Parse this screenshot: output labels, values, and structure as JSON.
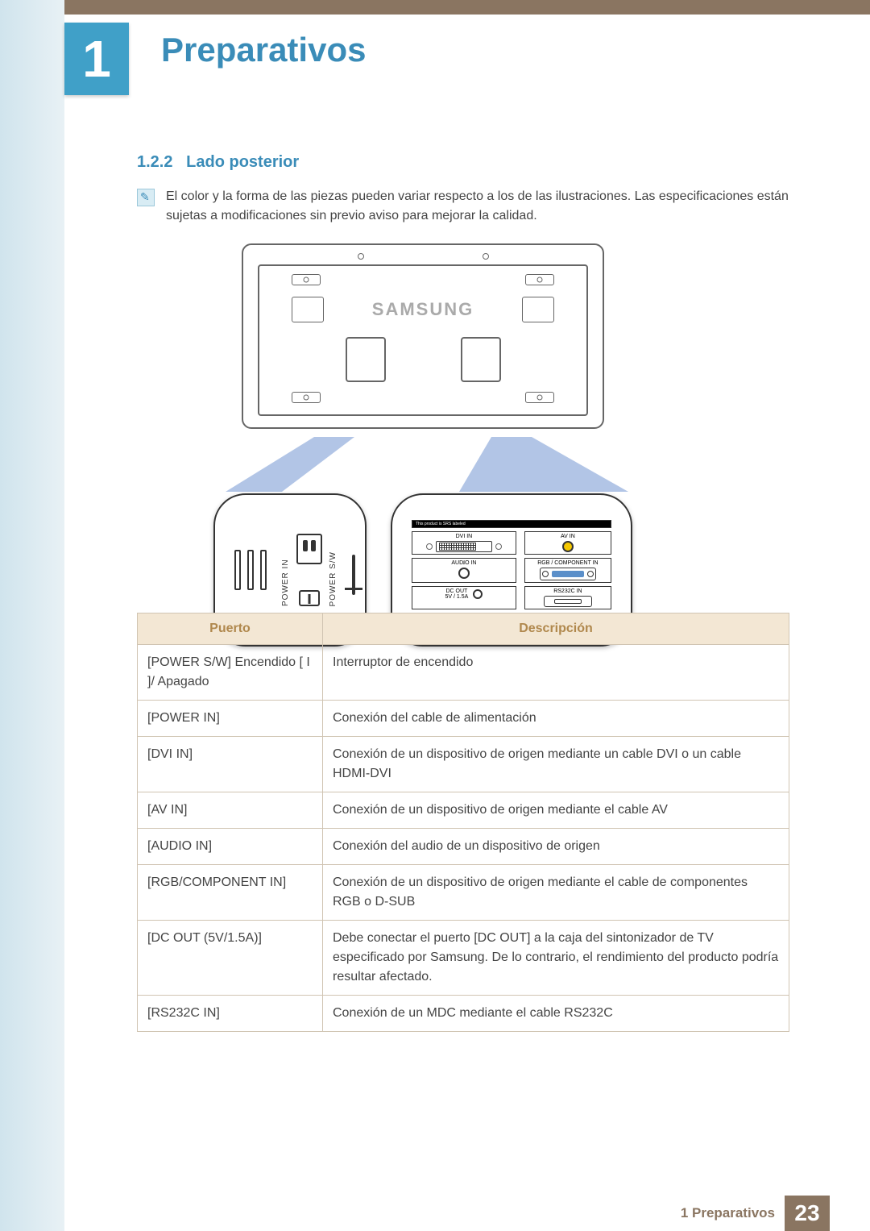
{
  "chapter": {
    "number": "1",
    "title": "Preparativos"
  },
  "section": {
    "number": "1.2.2",
    "title": "Lado posterior"
  },
  "note_text": "El color y la forma de las piezas pueden variar respecto a los de las ilustraciones. Las especificaciones están sujetas a modificaciones sin previo aviso para mejorar la calidad.",
  "brand": "SAMSUNG",
  "port_panel_left": {
    "power_in_label": "POWER IN",
    "power_sw_label": "POWER S/W"
  },
  "port_panel_right": {
    "dvi_in": "DVI IN",
    "av_in": "AV IN",
    "audio_in": "AUDIO IN",
    "rgb_component_in": "RGB / COMPONENT IN",
    "rs232c_in": "RS232C IN",
    "dc_out": "DC OUT",
    "dc_out_spec": "5V / 1.5A"
  },
  "table": {
    "header_port": "Puerto",
    "header_desc": "Descripción",
    "rows": [
      {
        "port": "[POWER S/W] Encendido [ I ]/ Apagado",
        "desc": "Interruptor de encendido"
      },
      {
        "port": "[POWER IN]",
        "desc": "Conexión del cable de alimentación"
      },
      {
        "port": "[DVI IN]",
        "desc": "Conexión de un dispositivo de origen mediante un cable DVI o un cable HDMI-DVI"
      },
      {
        "port": "[AV IN]",
        "desc": "Conexión de un dispositivo de origen mediante el cable AV"
      },
      {
        "port": "[AUDIO IN]",
        "desc": "Conexión del audio de un dispositivo de origen"
      },
      {
        "port": "[RGB/COMPONENT IN]",
        "desc": "Conexión de un dispositivo de origen mediante el cable de componentes RGB o D-SUB"
      },
      {
        "port": "[DC OUT (5V/1.5A)]",
        "desc": "Debe conectar el puerto [DC OUT] a la caja del sintonizador de TV especificado por Samsung. De lo contrario, el rendimiento del producto podría resultar afectado."
      },
      {
        "port": "[RS232C IN]",
        "desc": "Conexión de un MDC mediante el cable RS232C"
      }
    ]
  },
  "footer": {
    "label": "1 Preparativos",
    "page": "23"
  }
}
